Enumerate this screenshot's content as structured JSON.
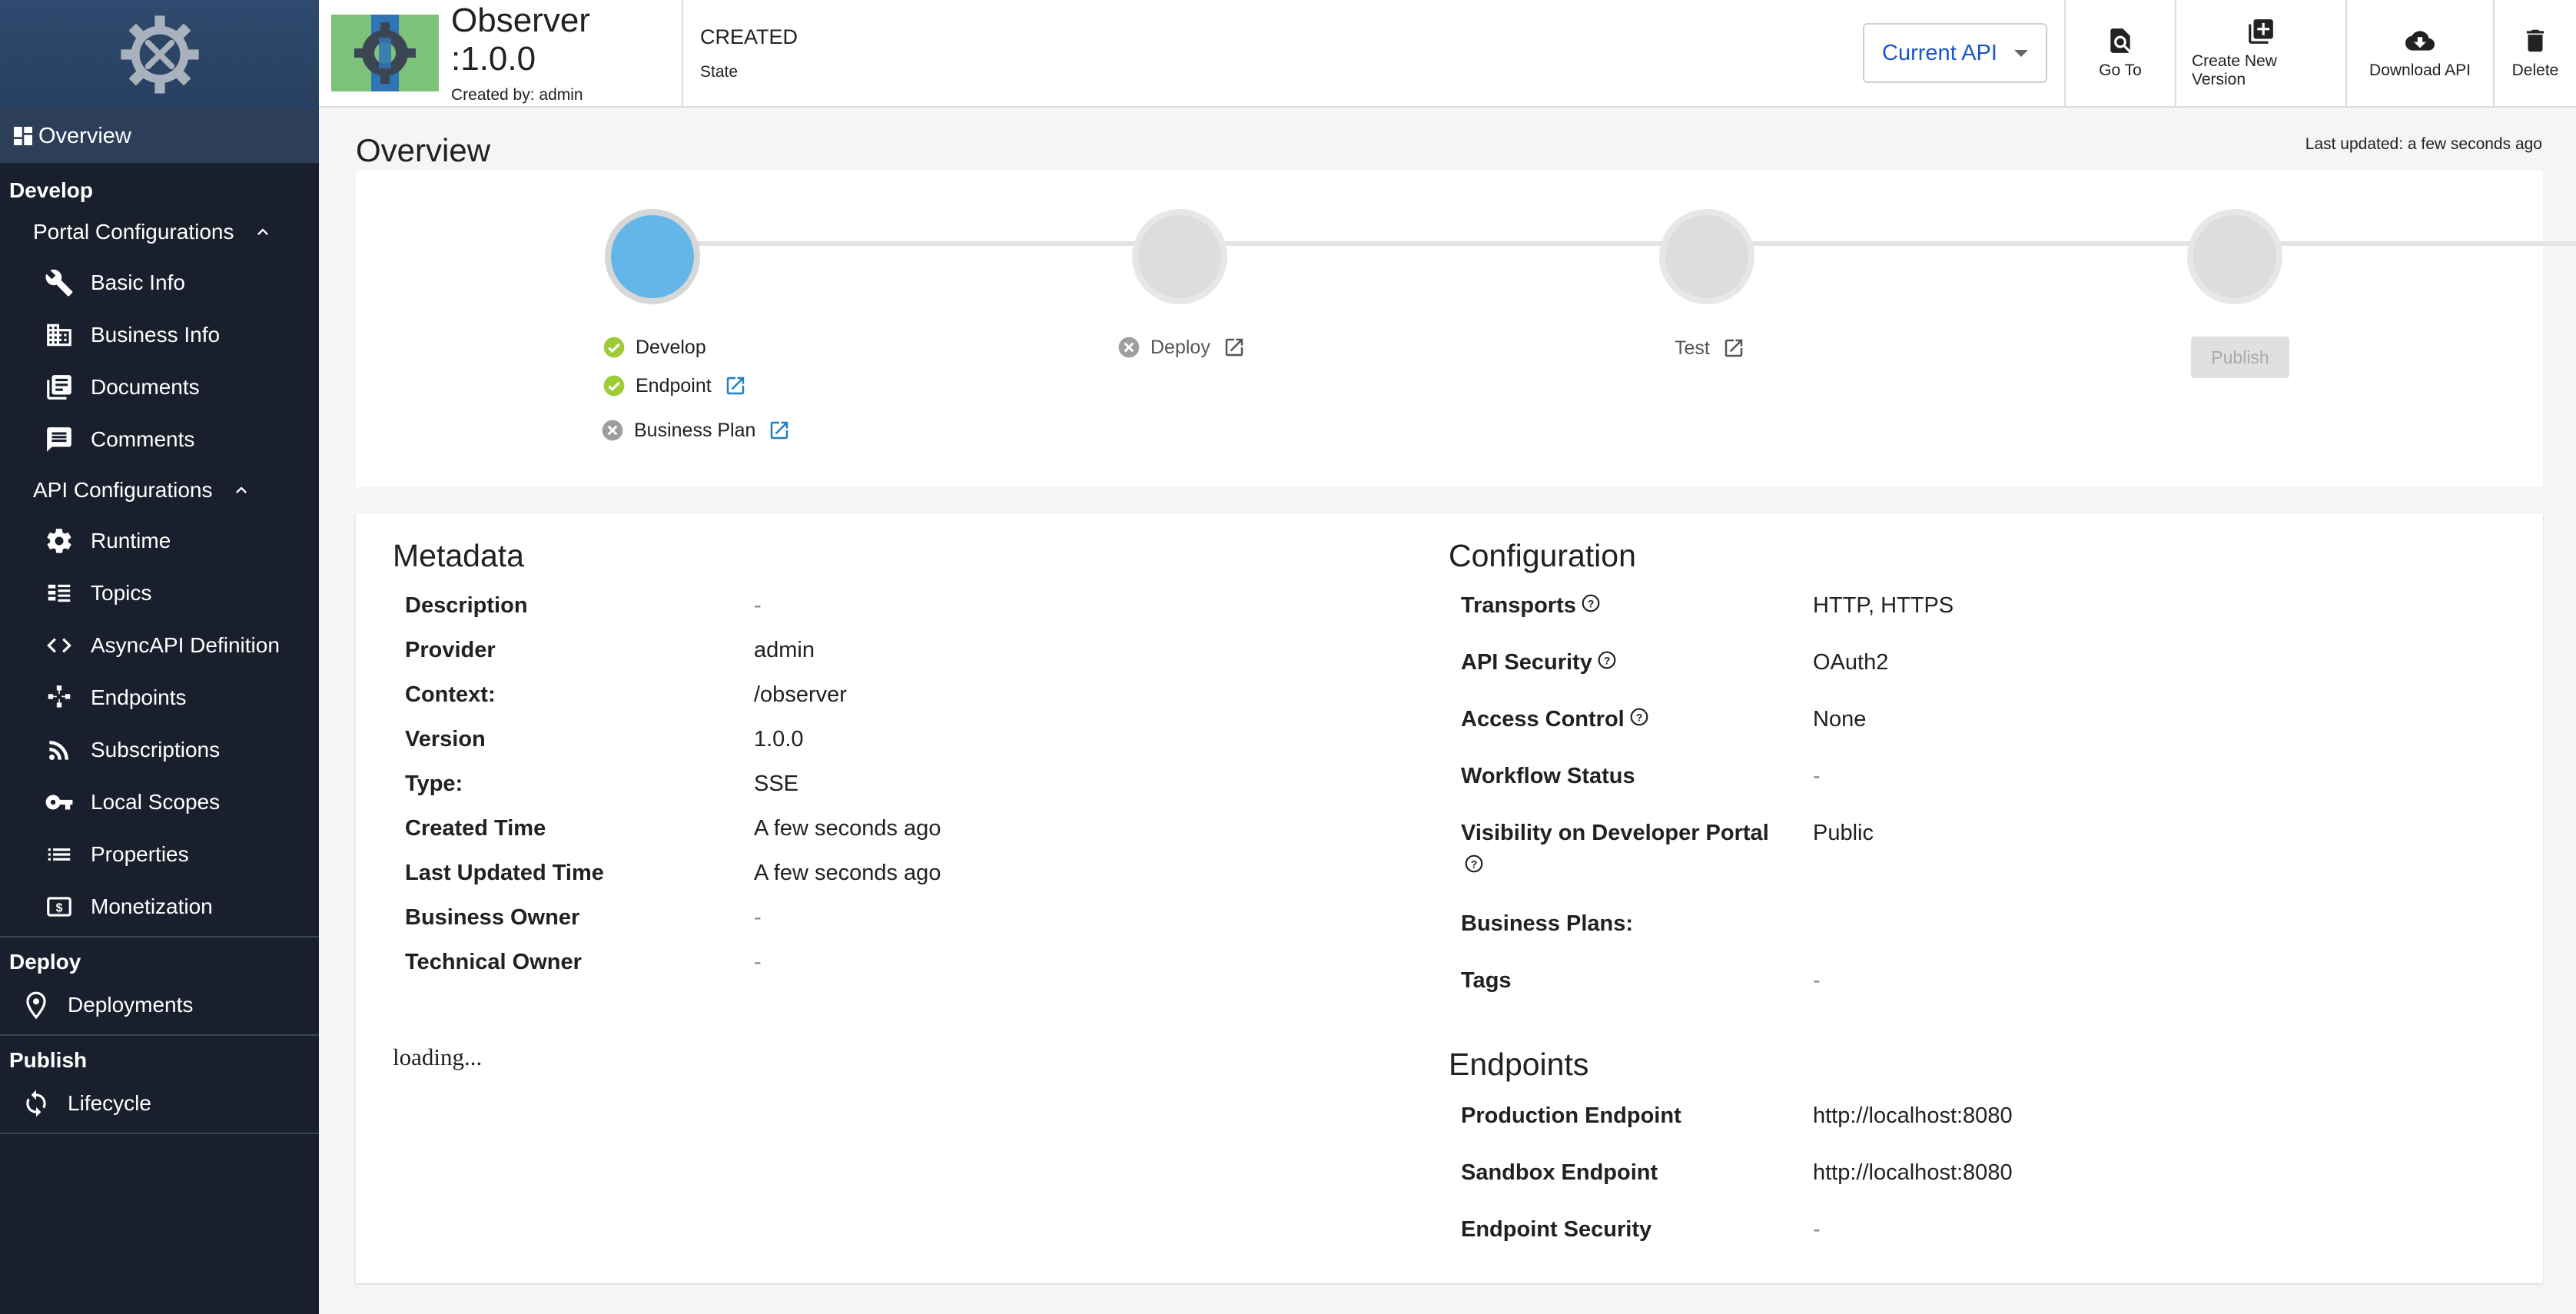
{
  "sidebar": {
    "overview": "Overview",
    "develop": "Develop",
    "portal_configurations": "Portal Configurations",
    "portal_items": [
      "Basic Info",
      "Business Info",
      "Documents",
      "Comments"
    ],
    "api_configurations": "API Configurations",
    "api_items": [
      "Runtime",
      "Topics",
      "AsyncAPI Definition",
      "Endpoints",
      "Subscriptions",
      "Local Scopes",
      "Properties",
      "Monetization"
    ],
    "deploy": "Deploy",
    "deployments": "Deployments",
    "publish": "Publish",
    "lifecycle": "Lifecycle"
  },
  "header": {
    "title": "Observer :1.0.0",
    "created_by": "Created by: admin",
    "state_value": "CREATED",
    "state_label": "State",
    "current_api": "Current API",
    "go_to": "Go To",
    "create_new_version": "Create New Version",
    "download_api": "Download API",
    "delete": "Delete"
  },
  "overview": {
    "title": "Overview",
    "last_updated": "Last updated: a few seconds ago"
  },
  "lifecycle": {
    "develop": "Develop",
    "endpoint": "Endpoint",
    "business_plan": "Business Plan",
    "deploy": "Deploy",
    "test": "Test",
    "publish": "Publish"
  },
  "metadata": {
    "title": "Metadata",
    "rows": [
      {
        "k": "Description",
        "v": "-"
      },
      {
        "k": "Provider",
        "v": "admin"
      },
      {
        "k": "Context:",
        "v": "/observer"
      },
      {
        "k": "Version",
        "v": "1.0.0"
      },
      {
        "k": "Type:",
        "v": "SSE"
      },
      {
        "k": "Created Time",
        "v": "A few seconds ago"
      },
      {
        "k": "Last Updated Time",
        "v": "A few seconds ago"
      },
      {
        "k": "Business Owner",
        "v": "-"
      },
      {
        "k": "Technical Owner",
        "v": "-"
      }
    ],
    "loading": "loading..."
  },
  "configuration": {
    "title": "Configuration",
    "transports_k": "Transports",
    "transports_v": "HTTP, HTTPS",
    "api_security_k": "API Security",
    "api_security_v": "OAuth2",
    "access_control_k": "Access Control",
    "access_control_v": "None",
    "workflow_status_k": "Workflow Status",
    "workflow_status_v": "-",
    "visibility_k": "Visibility on Developer Portal",
    "visibility_v": "Public",
    "business_plans_k": "Business Plans:",
    "tags_k": "Tags",
    "tags_v": "-"
  },
  "endpoints": {
    "title": "Endpoints",
    "production_k": "Production Endpoint",
    "production_v": "http://localhost:8080",
    "sandbox_k": "Sandbox Endpoint",
    "sandbox_v": "http://localhost:8080",
    "security_k": "Endpoint Security",
    "security_v": "-"
  }
}
